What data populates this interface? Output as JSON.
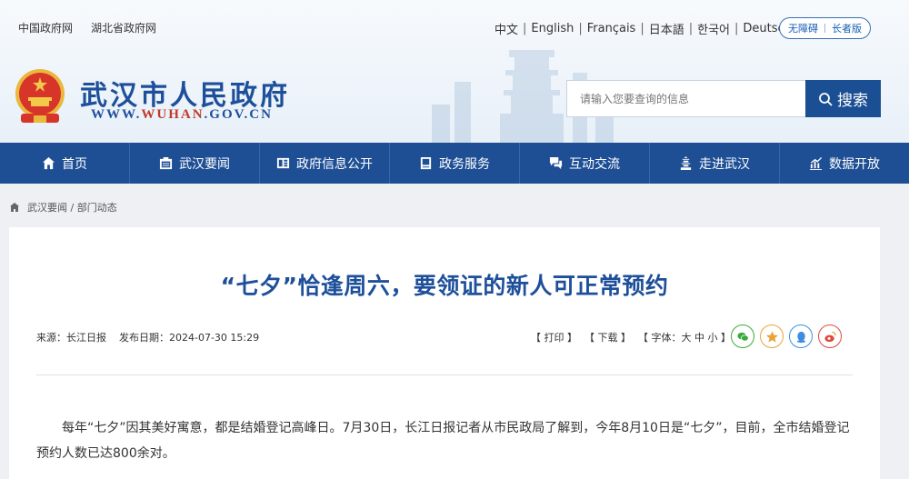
{
  "top_links": [
    "中国政府网",
    "湖北省政府网"
  ],
  "languages": [
    "中文",
    "English",
    "Français",
    "日本語",
    "한국어",
    "Deutsch"
  ],
  "accessibility": [
    "无障碍",
    "长者版"
  ],
  "site": {
    "title": "武汉市人民政府",
    "url_prefix": "WWW.",
    "url_brand": "WUHAN",
    "url_suffix": ".GOV.CN"
  },
  "search": {
    "placeholder": "请输入您要查询的信息",
    "button": "搜索",
    "icon": "search-icon"
  },
  "nav": [
    {
      "label": "首页",
      "icon": "home-icon"
    },
    {
      "label": "武汉要闻",
      "icon": "news-icon"
    },
    {
      "label": "政府信息公开",
      "icon": "info-icon"
    },
    {
      "label": "政务服务",
      "icon": "service-icon"
    },
    {
      "label": "互动交流",
      "icon": "chat-icon"
    },
    {
      "label": "走进武汉",
      "icon": "tower-icon"
    },
    {
      "label": "数据开放",
      "icon": "data-icon"
    }
  ],
  "breadcrumb": "武汉要闻 / 部门动态",
  "article": {
    "title": "“七夕”恰逢周六，要领证的新人可正常预约",
    "source": "来源：长江日报",
    "date": "发布日期：2024-07-30 15:29",
    "print": "【 打印 】",
    "download": "【 下载 】",
    "font_size": "【 字体：大 中 小 】",
    "share_icons": [
      "wechat-icon",
      "favorite-icon",
      "qq-icon",
      "weibo-icon"
    ],
    "paragraph": "每年“七夕”因其美好寓意，都是结婚登记高峰日。7月30日，长江日报记者从市民政局了解到，今年8月10日是“七夕”，目前，全市结婚登记预约人数已达800余对。"
  },
  "colors": {
    "primary": "#1e4f95",
    "title": "#1d4f9a",
    "accent": "#c0392b",
    "wechat": "#3aab3a",
    "fav": "#e8a33a",
    "qq": "#3b8ee0",
    "weibo": "#e0483a"
  }
}
